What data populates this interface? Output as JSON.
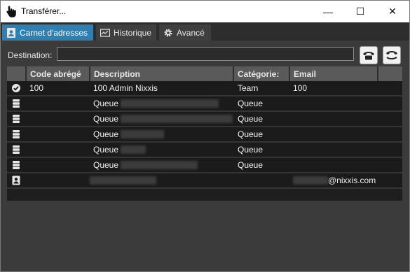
{
  "window": {
    "title": "Transférer..."
  },
  "controls": {
    "minimize": "—",
    "maximize": "☐",
    "close": "✕"
  },
  "tabs": [
    {
      "label": "Carnet d'adresses",
      "icon": "address-book-icon",
      "active": true
    },
    {
      "label": "Historique",
      "icon": "history-icon",
      "active": false
    },
    {
      "label": "Avancé",
      "icon": "gear-icon",
      "active": false
    }
  ],
  "destination": {
    "label": "Destination:",
    "value": "",
    "placeholder": ""
  },
  "table": {
    "columns": [
      "Code abrégé",
      "Description",
      "Catégorie:",
      "Email"
    ],
    "rows": [
      {
        "icon": "check-circle-icon",
        "code": "100",
        "description": "100 Admin Nixxis",
        "category": "Team",
        "email": "100"
      },
      {
        "icon": "queue-icon",
        "code": "",
        "description": "Queue",
        "category": "Queue",
        "email": ""
      },
      {
        "icon": "queue-icon",
        "code": "",
        "description": "Queue",
        "category": "Queue",
        "email": ""
      },
      {
        "icon": "queue-icon",
        "code": "",
        "description": "Queue",
        "category": "Queue",
        "email": ""
      },
      {
        "icon": "queue-icon",
        "code": "",
        "description": "Queue",
        "category": "Queue",
        "email": ""
      },
      {
        "icon": "queue-icon",
        "code": "",
        "description": "Queue",
        "category": "Queue",
        "email": ""
      },
      {
        "icon": "contact-card-icon",
        "code": "",
        "description": "",
        "category": "",
        "email": "@nixxis.com"
      }
    ]
  },
  "colors": {
    "accent": "#2f7fb0",
    "background": "#3b3b3b",
    "row": "#1b1b1b",
    "header": "#5a5a5a"
  }
}
